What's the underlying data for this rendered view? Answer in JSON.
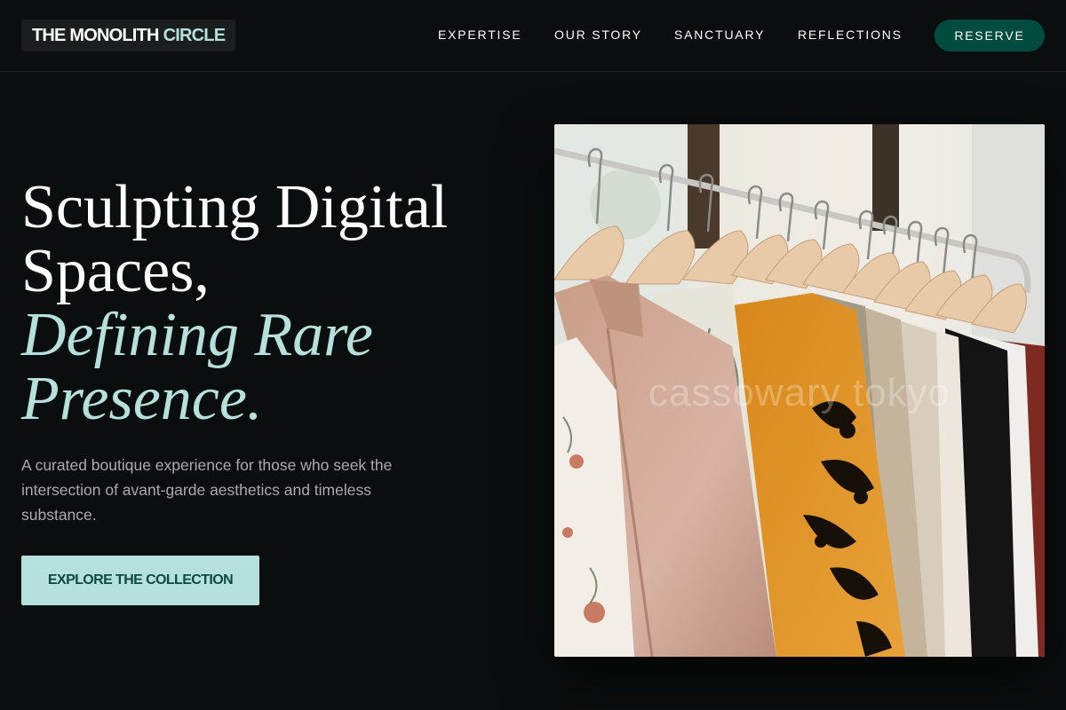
{
  "brand": {
    "name_part1": "THE MONOLITH",
    "name_part2": "CIRCLE"
  },
  "nav": {
    "items": [
      {
        "label": "EXPERTISE"
      },
      {
        "label": "OUR STORY"
      },
      {
        "label": "SANCTUARY"
      },
      {
        "label": "REFLECTIONS"
      }
    ],
    "reserve_label": "RESERVE"
  },
  "hero": {
    "headline_line1": "Sculpting Digital",
    "headline_line2": "Spaces,",
    "headline_accent_line1": "Defining Rare",
    "headline_accent_line2": "Presence.",
    "subtext": "A curated boutique experience for those who seek the intersection of avant-garde aesthetics and timeless substance.",
    "cta_label": "EXPLORE THE COLLECTION",
    "image_watermark": "cassowary tokyo"
  },
  "colors": {
    "background": "#0b0e0e",
    "accent_mint": "#b6e0dc",
    "reserve_green": "#004d40",
    "cta_text": "#0d4a42",
    "muted_text": "#a6adae"
  }
}
